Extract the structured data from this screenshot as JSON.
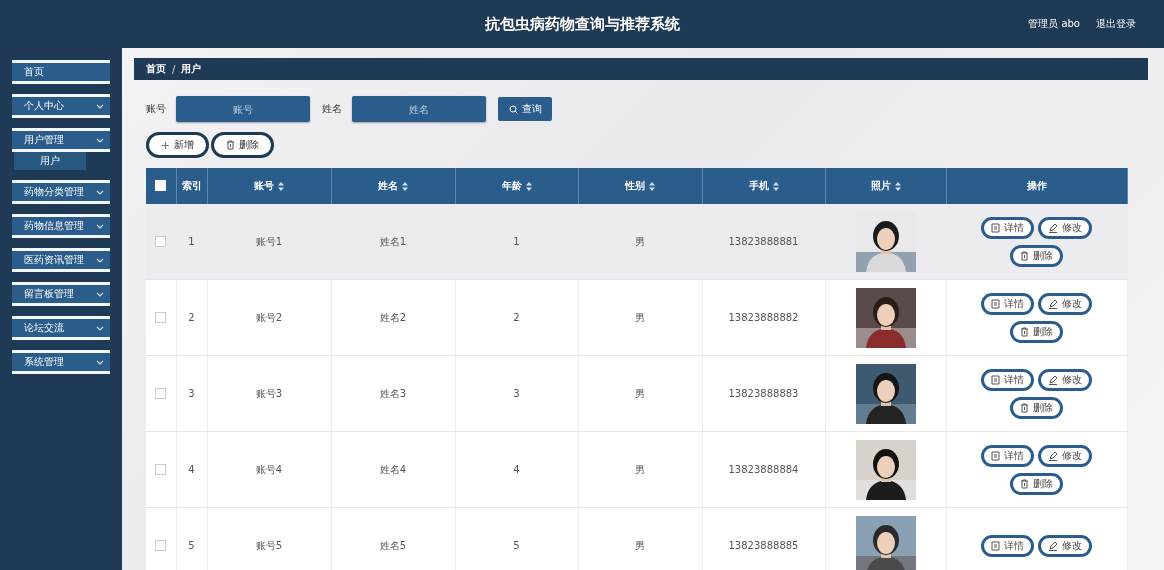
{
  "header": {
    "title": "抗包虫病药物查询与推荐系统",
    "user": "管理员 abo",
    "logout": "退出登录"
  },
  "sidebar": {
    "items": [
      {
        "label": "首页",
        "has_caret": false
      },
      {
        "label": "个人中心",
        "has_caret": true
      },
      {
        "label": "用户管理",
        "has_caret": true,
        "children": [
          {
            "label": "用户",
            "selected": true
          }
        ]
      },
      {
        "label": "药物分类管理",
        "has_caret": true
      },
      {
        "label": "药物信息管理",
        "has_caret": true
      },
      {
        "label": "医药资讯管理",
        "has_caret": true
      },
      {
        "label": "留言板管理",
        "has_caret": true
      },
      {
        "label": "论坛交流",
        "has_caret": true
      },
      {
        "label": "系统管理",
        "has_caret": true
      }
    ]
  },
  "breadcrumb": {
    "separator": "/",
    "items": [
      "首页",
      "用户"
    ]
  },
  "search": {
    "fields": [
      {
        "label": "账号",
        "placeholder": "账号"
      },
      {
        "label": "姓名",
        "placeholder": "姓名"
      }
    ],
    "button": "查询"
  },
  "actions": [
    {
      "label": "新增",
      "kind": "add"
    },
    {
      "label": "删除",
      "kind": "delete"
    }
  ],
  "table": {
    "header_checked": false,
    "columns": [
      {
        "label": "索引",
        "sortable": false
      },
      {
        "label": "账号",
        "sortable": true
      },
      {
        "label": "姓名",
        "sortable": true
      },
      {
        "label": "年龄",
        "sortable": true
      },
      {
        "label": "性别",
        "sortable": true
      },
      {
        "label": "手机",
        "sortable": true
      },
      {
        "label": "照片",
        "sortable": true
      },
      {
        "label": "操作",
        "sortable": false
      }
    ],
    "rows": [
      {
        "checked": false,
        "hovered": true,
        "cells": [
          "1",
          "账号1",
          "姓名1",
          "1",
          "男",
          "13823888881"
        ],
        "buttons": [
          {
            "label": "详情",
            "kind": "detail"
          },
          {
            "label": "修改",
            "kind": "edit"
          },
          {
            "label": "删除",
            "kind": "delete"
          }
        ]
      },
      {
        "checked": false,
        "hovered": false,
        "cells": [
          "2",
          "账号2",
          "姓名2",
          "2",
          "男",
          "13823888882"
        ],
        "buttons": [
          {
            "label": "详情",
            "kind": "detail"
          },
          {
            "label": "修改",
            "kind": "edit"
          },
          {
            "label": "删除",
            "kind": "delete"
          }
        ]
      },
      {
        "checked": false,
        "hovered": false,
        "cells": [
          "3",
          "账号3",
          "姓名3",
          "3",
          "男",
          "13823888883"
        ],
        "buttons": [
          {
            "label": "详情",
            "kind": "detail"
          },
          {
            "label": "修改",
            "kind": "edit"
          },
          {
            "label": "删除",
            "kind": "delete"
          }
        ]
      },
      {
        "checked": false,
        "hovered": false,
        "cells": [
          "4",
          "账号4",
          "姓名4",
          "4",
          "男",
          "13823888884"
        ],
        "buttons": [
          {
            "label": "详情",
            "kind": "detail"
          },
          {
            "label": "修改",
            "kind": "edit"
          },
          {
            "label": "删除",
            "kind": "delete"
          }
        ]
      },
      {
        "checked": false,
        "hovered": false,
        "cells": [
          "5",
          "账号5",
          "姓名5",
          "5",
          "男",
          "13823888885"
        ],
        "buttons": [
          {
            "label": "详情",
            "kind": "detail"
          },
          {
            "label": "修改",
            "kind": "edit"
          }
        ]
      }
    ]
  }
}
